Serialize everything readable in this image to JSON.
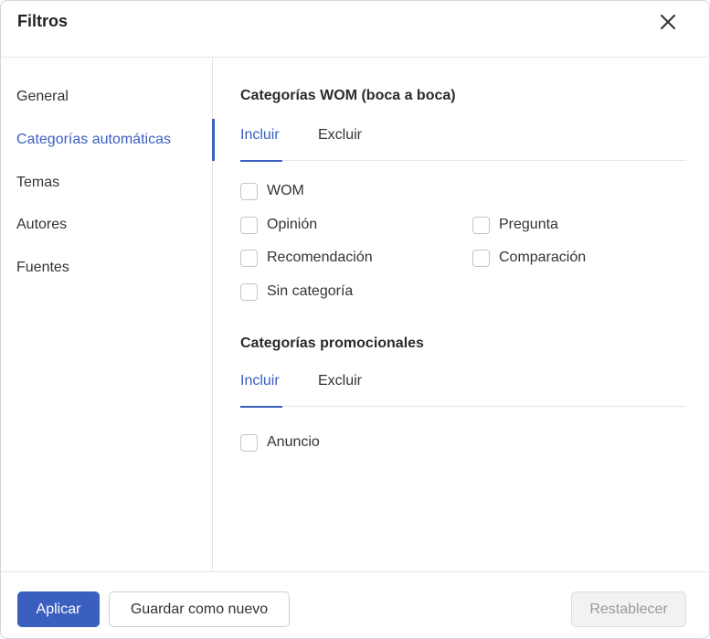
{
  "dialog": {
    "title": "Filtros"
  },
  "sidebar": {
    "items": [
      {
        "label": "General"
      },
      {
        "label": "Categorías automáticas"
      },
      {
        "label": "Temas"
      },
      {
        "label": "Autores"
      },
      {
        "label": "Fuentes"
      }
    ],
    "active_index": 1
  },
  "wom": {
    "title": "Categorías WOM (boca a boca)",
    "tabs": [
      {
        "label": "Incluir"
      },
      {
        "label": "Excluir"
      }
    ],
    "options": [
      {
        "label": "WOM",
        "checked": false
      },
      {
        "label": "Opinión",
        "checked": false
      },
      {
        "label": "Pregunta",
        "checked": false
      },
      {
        "label": "Recomendación",
        "checked": false
      },
      {
        "label": "Comparación",
        "checked": false
      },
      {
        "label": "Sin categoría",
        "checked": false
      }
    ]
  },
  "promo": {
    "title": "Categorías promocionales",
    "tabs": [
      {
        "label": "Incluir"
      },
      {
        "label": "Excluir"
      }
    ],
    "options": [
      {
        "label": "Anuncio",
        "checked": false
      }
    ]
  },
  "footer": {
    "apply_label": "Aplicar",
    "save_new_label": "Guardar como nuevo",
    "reset_label": "Restablecer"
  },
  "colors": {
    "accent": "#3a5fbf",
    "border": "#e6e6e6"
  },
  "icons": {
    "close": "close-icon"
  }
}
